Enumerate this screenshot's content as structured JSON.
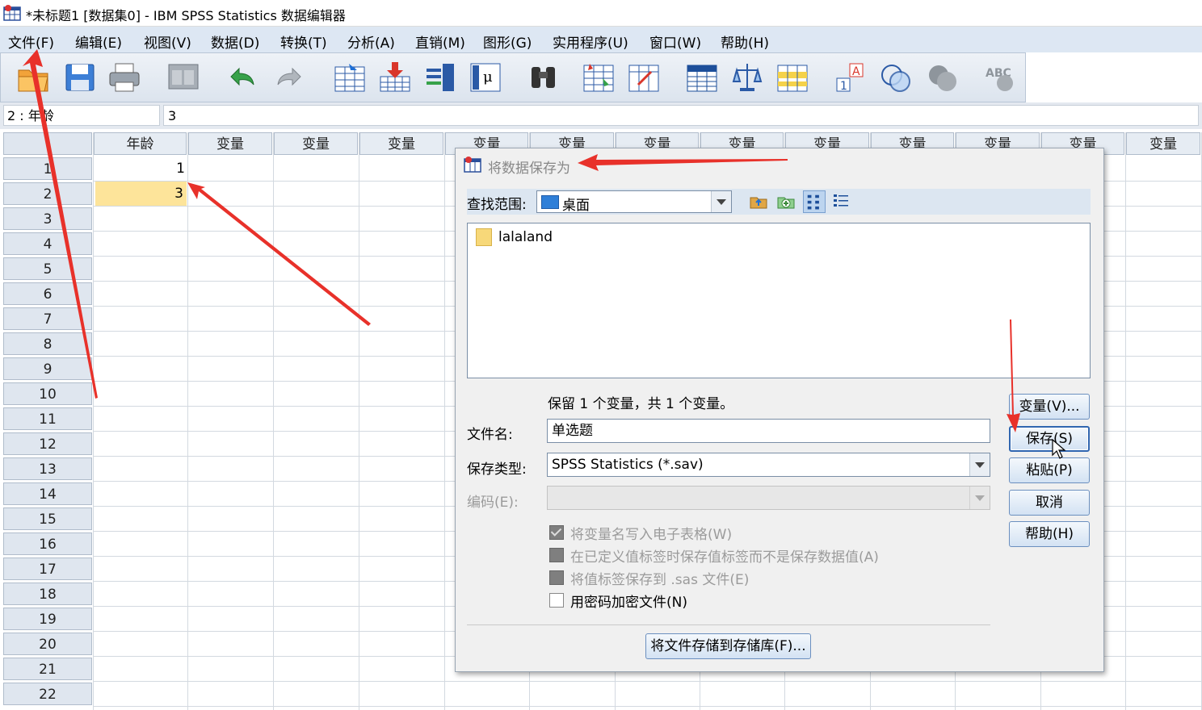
{
  "window": {
    "title": "*未标题1 [数据集0] - IBM SPSS Statistics 数据编辑器"
  },
  "menu": [
    "文件(F)",
    "编辑(E)",
    "视图(V)",
    "数据(D)",
    "转换(T)",
    "分析(A)",
    "直销(M)",
    "图形(G)",
    "实用程序(U)",
    "窗口(W)",
    "帮助(H)"
  ],
  "toolbar": {
    "icons": [
      "open-folder-icon",
      "save-disk-icon",
      "print-icon",
      "dialog-recall-icon",
      "undo-icon",
      "redo-icon",
      "goto-case-icon",
      "goto-variable-icon",
      "variables-icon",
      "descriptive-stats-icon",
      "find-icon",
      "insert-cases-icon",
      "insert-variable-icon",
      "split-file-icon",
      "weight-cases-icon",
      "select-cases-icon",
      "value-labels-icon",
      "use-sets-icon",
      "show-all-variables-icon",
      "spell-check-icon"
    ]
  },
  "cell_editor": {
    "ref": "2 : 年龄",
    "value": "3"
  },
  "grid": {
    "columns": [
      "年龄",
      "变量",
      "变量",
      "变量",
      "变量",
      "变量",
      "变量",
      "变量",
      "变量",
      "变量",
      "变量",
      "变量",
      "变量"
    ],
    "row_numbers": [
      "1",
      "2",
      "3",
      "4",
      "5",
      "6",
      "7",
      "8",
      "9",
      "10",
      "11",
      "12",
      "13",
      "14",
      "15",
      "16",
      "17",
      "18",
      "19",
      "20",
      "21",
      "22"
    ],
    "values": [
      "1",
      "3"
    ]
  },
  "dialog": {
    "title": "将数据保存为",
    "look_in_label": "查找范围:",
    "look_in_value": "桌面",
    "files": [
      "lalaland"
    ],
    "keep_info": "保留 1 个变量，共 1 个变量。",
    "filename_label": "文件名:",
    "filename_value": "单选题",
    "type_label": "保存类型:",
    "type_value": "SPSS Statistics (*.sav)",
    "encoding_label": "编码(E):",
    "checkboxes": [
      {
        "label": "将变量名写入电子表格(W)",
        "state": "checked-disabled"
      },
      {
        "label": "在已定义值标签时保存值标签而不是保存数据值(A)",
        "state": "disabled"
      },
      {
        "label": "将值标签保存到 .sas 文件(E)",
        "state": "disabled"
      },
      {
        "label": "用密码加密文件(N)",
        "state": "enabled"
      }
    ],
    "buttons": {
      "variables": "变量(V)...",
      "save": "保存(S)",
      "paste": "粘贴(P)",
      "cancel": "取消",
      "help": "帮助(H)"
    },
    "repository_button": "将文件存储到存储库(F)..."
  },
  "colors": {
    "annotation_arrow": "#e8312a",
    "selected_cell": "#fde49a",
    "menu_bg": "#dde7f3"
  }
}
